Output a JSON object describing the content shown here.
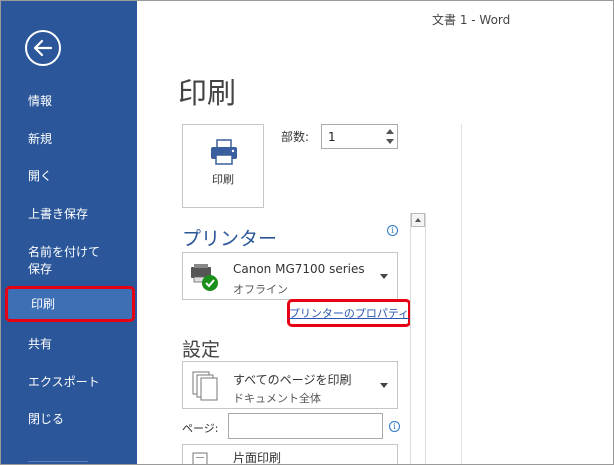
{
  "window": {
    "title": "文書 1 - Word"
  },
  "sidebar": {
    "back_label": "戻る",
    "items": [
      {
        "label": "情報"
      },
      {
        "label": "新規"
      },
      {
        "label": "開く"
      },
      {
        "label": "上書き保存"
      },
      {
        "label": "名前を付けて\n保存"
      },
      {
        "label": "印刷",
        "active": true
      },
      {
        "label": "共有"
      },
      {
        "label": "エクスポート"
      },
      {
        "label": "閉じる"
      }
    ]
  },
  "main": {
    "page_title": "印刷",
    "print_button": {
      "label": "印刷",
      "icon": "printer-icon"
    },
    "copies": {
      "label": "部数:",
      "value": "1"
    },
    "printer_section": {
      "heading": "プリンター",
      "selected_printer": "Canon MG7100 series",
      "status": "オフライン",
      "properties_link": "プリンターのプロパティ"
    },
    "settings_section": {
      "heading": "設定",
      "print_range": {
        "line1": "すべてのページを印刷",
        "line2": "ドキュメント全体"
      },
      "pages_label": "ページ:",
      "pages_value": "",
      "sides": {
        "line1": "片面印刷"
      }
    }
  },
  "colors": {
    "sidebar": "#2b579a",
    "highlight_border": "#e60012",
    "accent": "#2b579a"
  }
}
